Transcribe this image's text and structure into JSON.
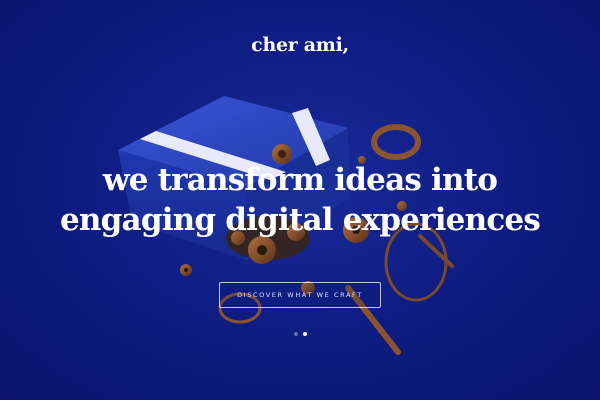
{
  "brand": {
    "logo_text": "cher ami,"
  },
  "hero": {
    "headline_line1": "we transform ideas into",
    "headline_line2": "engaging digital experiences",
    "cta_label": "DISCOVER WHAT WE CRAFT"
  },
  "carousel": {
    "slide_count": 2,
    "active_index": 1
  },
  "colors": {
    "background": "#0f1d83",
    "box": "#2b45c4",
    "rings": "#7a4a2a",
    "text": "#ffffff"
  },
  "icons": [
    "gift-box-illustration",
    "copper-ring",
    "gear"
  ]
}
